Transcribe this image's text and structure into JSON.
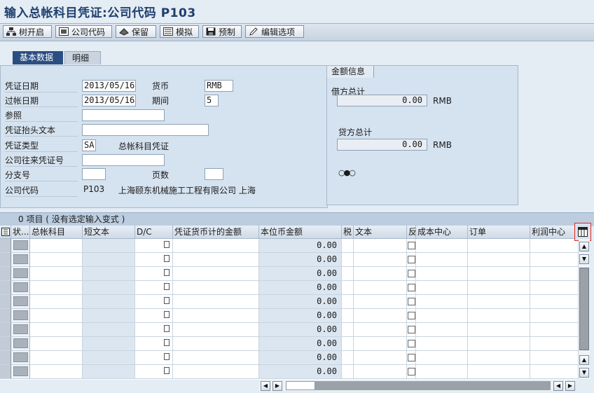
{
  "window_title": "输入总帐科目凭证:公司代码 P103",
  "toolbar": {
    "tree_label": "树开启",
    "company_label": "公司代码",
    "hold_label": "保留",
    "simulate_label": "模拟",
    "park_label": "预制",
    "options_label": "编辑选项"
  },
  "tabs": {
    "basic": "基本数据",
    "detail": "明细"
  },
  "form": {
    "doc_date_label": "凭证日期",
    "doc_date": "2013/05/16",
    "currency_label": "货币",
    "currency": "RMB",
    "post_date_label": "过帐日期",
    "post_date": "2013/05/16",
    "period_label": "期间",
    "period": "5",
    "ref_label": "参照",
    "ref": "",
    "header_text_label": "凭证抬头文本",
    "header_text": "",
    "doc_type_label": "凭证类型",
    "doc_type": "SA",
    "doc_type_desc": "总帐科目凭证",
    "intercompany_label": "公司往来凭证号",
    "intercompany": "",
    "branch_label": "分支号",
    "branch": "",
    "pages_label": "页数",
    "pages": "",
    "company_code_label": "公司代码",
    "company_code": "P103",
    "company_name": "上海颐东机械施工工程有限公司 上海"
  },
  "amounts": {
    "group_title": "金额信息",
    "debit_label": "借方总计",
    "debit_value": "0.00",
    "debit_currency": "RMB",
    "credit_label": "贷方总计",
    "credit_value": "0.00",
    "credit_currency": "RMB",
    "status_glyph": "○●○"
  },
  "grid": {
    "title": "0 项目 ( 没有选定输入变式 )",
    "columns": [
      "状...",
      "总帐科目",
      "短文本",
      "D/C",
      "凭证货币计的金额",
      "本位币金额",
      "税",
      "文本",
      "反",
      "成本中心",
      "订单",
      "利润中心"
    ],
    "row_amount": "0.00",
    "row_count": 10
  },
  "colors": {
    "title": "#1e3f6e",
    "tab_active": "#2b4e82",
    "panel": "#d5e2ef",
    "highlight": "#e0281e"
  }
}
